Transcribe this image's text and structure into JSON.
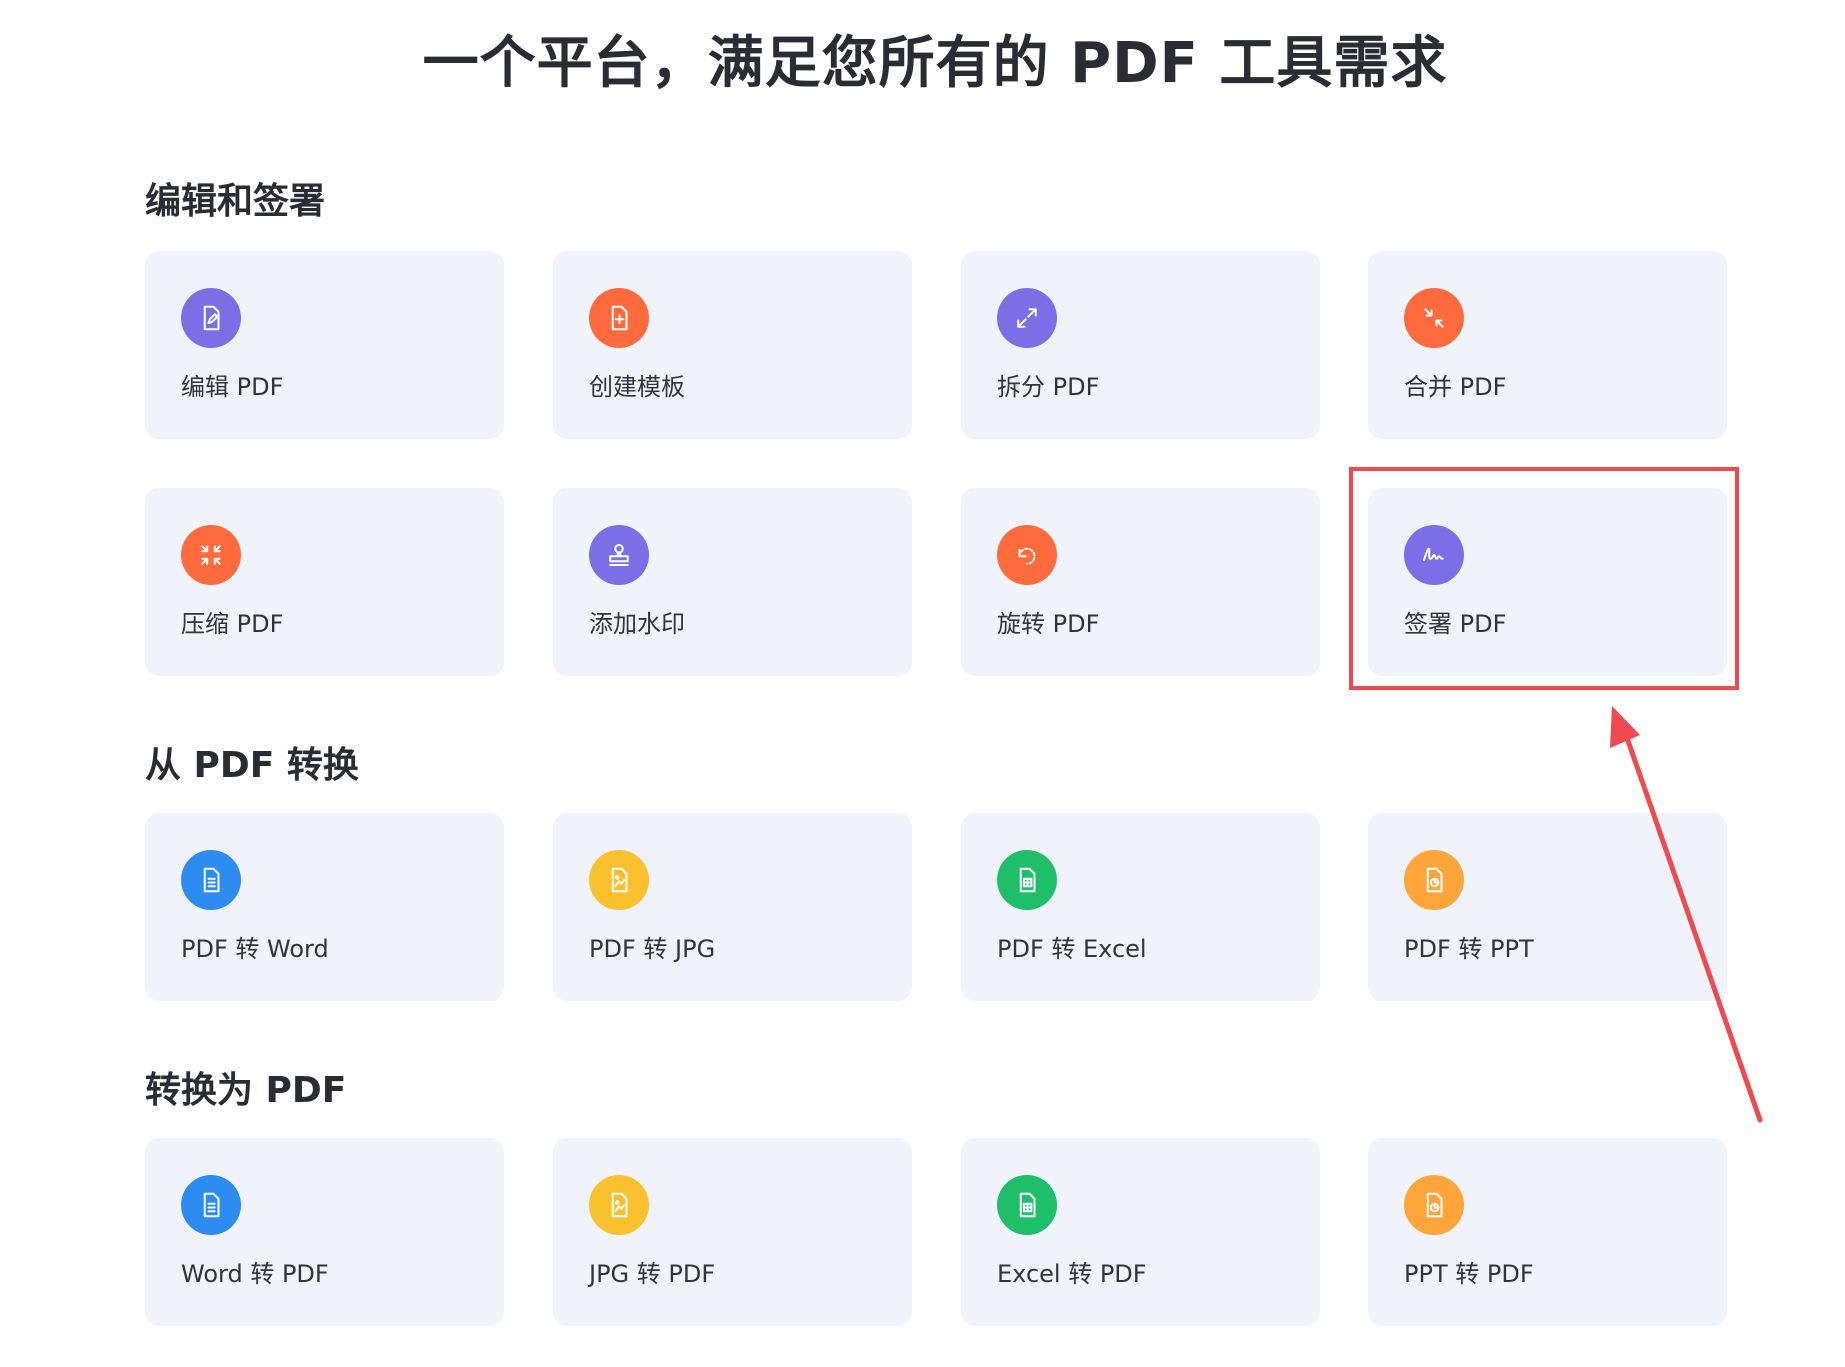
{
  "header": {
    "title": "一个平台，满足您所有的 PDF 工具需求"
  },
  "sections": [
    {
      "title": "编辑和签署",
      "cards": [
        {
          "label": "编辑 PDF",
          "icon": "edit-document-icon",
          "color": "#7c6ee6"
        },
        {
          "label": "创建模板",
          "icon": "add-document-icon",
          "color": "#ff6b3d"
        },
        {
          "label": "拆分 PDF",
          "icon": "expand-arrows-icon",
          "color": "#7c6ee6"
        },
        {
          "label": "合并 PDF",
          "icon": "merge-arrows-icon",
          "color": "#ff6b3d"
        },
        {
          "label": "压缩 PDF",
          "icon": "compress-arrows-icon",
          "color": "#ff6b3d"
        },
        {
          "label": "添加水印",
          "icon": "stamp-icon",
          "color": "#7c6ee6"
        },
        {
          "label": "旋转 PDF",
          "icon": "rotate-icon",
          "color": "#ff6b3d"
        },
        {
          "label": "签署 PDF",
          "icon": "signature-icon",
          "color": "#7c6ee6"
        }
      ]
    },
    {
      "title": "从 PDF 转换",
      "cards": [
        {
          "label": "PDF 转 Word",
          "icon": "word-document-icon",
          "color": "#2d8cf0"
        },
        {
          "label": "PDF 转 JPG",
          "icon": "image-document-icon",
          "color": "#fbc02d"
        },
        {
          "label": "PDF 转 Excel",
          "icon": "spreadsheet-document-icon",
          "color": "#1fbf6a"
        },
        {
          "label": "PDF 转 PPT",
          "icon": "presentation-document-icon",
          "color": "#ffa53a"
        }
      ]
    },
    {
      "title": "转换为 PDF",
      "cards": [
        {
          "label": "Word 转 PDF",
          "icon": "word-document-icon",
          "color": "#2d8cf0"
        },
        {
          "label": "JPG 转 PDF",
          "icon": "image-document-icon",
          "color": "#fbc02d"
        },
        {
          "label": "Excel 转 PDF",
          "icon": "spreadsheet-document-icon",
          "color": "#1fbf6a"
        },
        {
          "label": "PPT 转 PDF",
          "icon": "presentation-document-icon",
          "color": "#ffa53a"
        }
      ]
    }
  ],
  "annotation": {
    "highlight_color": "#ee4a4f"
  }
}
